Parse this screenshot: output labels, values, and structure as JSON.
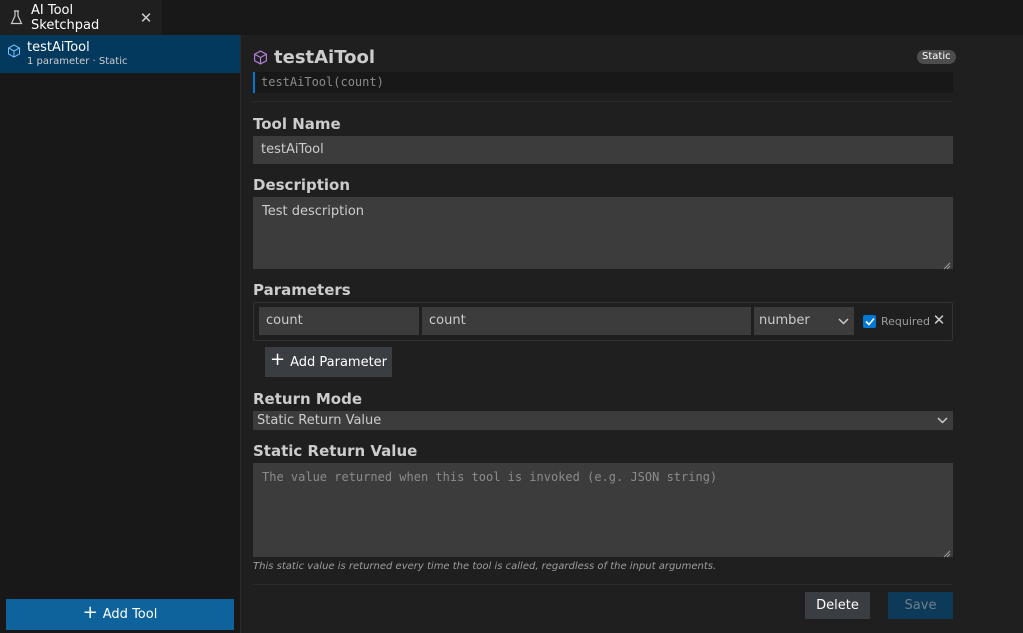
{
  "tab": {
    "label": "AI Tool Sketchpad",
    "icon": "beaker-icon",
    "close_icon": "close-icon"
  },
  "sidebar": {
    "tools": [
      {
        "name": "testAiTool",
        "subtitle": "1 parameter · Static",
        "icon": "cube-icon"
      }
    ],
    "add_tool_label": "Add Tool"
  },
  "editor": {
    "title": "testAiTool",
    "badge": "Static",
    "signature": "testAiTool(count)",
    "tool_name_label": "Tool Name",
    "tool_name_value": "testAiTool",
    "description_label": "Description",
    "description_value": "Test description",
    "parameters_label": "Parameters",
    "parameters": [
      {
        "name": "count",
        "description": "count",
        "type": "number",
        "required_label": "Required",
        "required": true
      }
    ],
    "add_parameter_label": "Add Parameter",
    "return_mode_label": "Return Mode",
    "return_mode_value": "Static Return Value",
    "static_return_label": "Static Return Value",
    "static_return_placeholder": "The value returned when this tool is invoked (e.g. JSON string)",
    "static_hint": "This static value is returned every time the tool is called, regardless of the input arguments.",
    "delete_label": "Delete",
    "save_label": "Save"
  },
  "colors": {
    "accent": "#0078d4",
    "button_primary": "#0e639c",
    "selection": "#04395e",
    "icon_purple": "#b180d7"
  }
}
